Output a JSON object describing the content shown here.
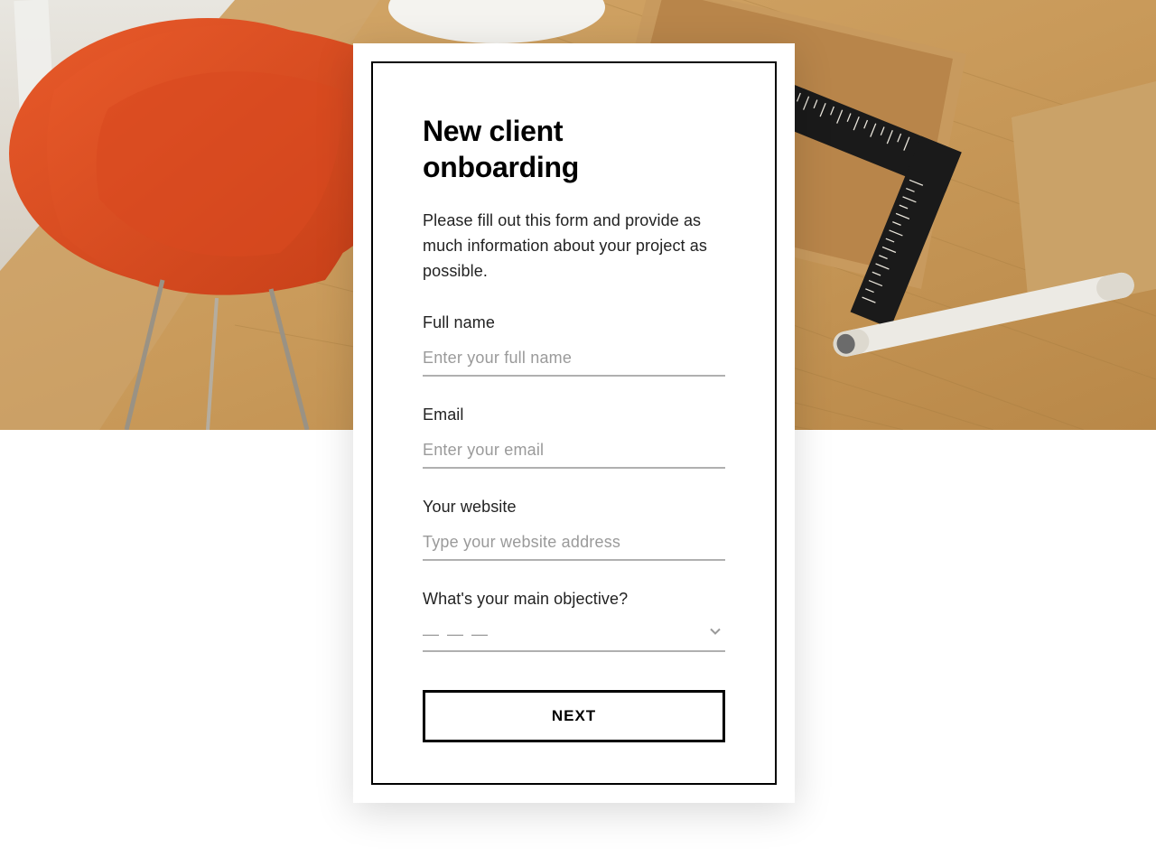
{
  "form": {
    "title": "New client onboarding",
    "description": "Please fill out this form and provide as much information about your project as possible.",
    "fields": {
      "fullname": {
        "label": "Full name",
        "placeholder": "Enter your full name",
        "value": ""
      },
      "email": {
        "label": "Email",
        "placeholder": "Enter your email",
        "value": ""
      },
      "website": {
        "label": "Your website",
        "placeholder": "Type your website address",
        "value": ""
      },
      "objective": {
        "label": "What's your main objective?",
        "placeholder": "— — —",
        "value": ""
      }
    },
    "next_button": "NEXT"
  }
}
